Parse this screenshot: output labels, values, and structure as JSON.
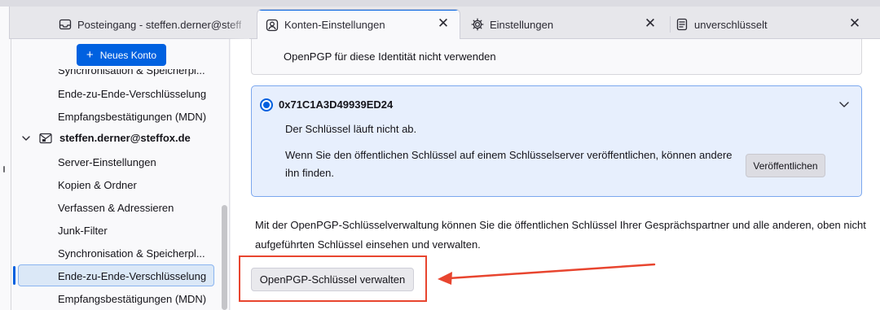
{
  "tabs": [
    {
      "title": "Posteingang - steffen.derner@steffox.d",
      "icon": "inbox-icon",
      "active": false
    },
    {
      "title": "Konten-Einstellungen",
      "icon": "account-settings-icon",
      "active": true
    },
    {
      "title": "Einstellungen",
      "icon": "gear-icon",
      "active": false
    },
    {
      "title": "unverschlüsselt",
      "icon": "document-icon",
      "active": false
    }
  ],
  "sidebar": {
    "new_account_label": "Neues Konto",
    "items_above": [
      "Synchronisation & Speicherpl...",
      "Ende-zu-Ende-Verschlüsselung",
      "Empfangsbestätigungen (MDN)"
    ],
    "account": "steffen.derner@steffox.de",
    "items": [
      "Server-Einstellungen",
      "Kopien & Ordner",
      "Verfassen & Adressieren",
      "Junk-Filter",
      "Synchronisation & Speicherpl...",
      "Ende-zu-Ende-Verschlüsselung",
      "Empfangsbestätigungen (MDN)"
    ],
    "selected_index": 5
  },
  "main": {
    "no_openpgp_label": "OpenPGP für diese Identität nicht verwenden",
    "key": {
      "id": "0x71C1A3D49939ED24",
      "expiry": "Der Schlüssel läuft nicht ab.",
      "publish_text": "Wenn Sie den öffentlichen Schlüssel auf einem Schlüsselserver veröffentlichen, können andere ihn finden.",
      "publish_button": "Veröffentlichen"
    },
    "management_text": "Mit der OpenPGP-Schlüsselverwaltung können Sie die öffentlichen Schlüssel Ihrer Gesprächspartner und alle anderen, oben nicht aufgeführten Schlüssel einsehen und verwalten.",
    "manage_button": "OpenPGP-Schlüssel verwalten"
  },
  "colors": {
    "accent": "#0060df",
    "annotation": "#e8452f",
    "selected_card_bg": "#e7effd"
  }
}
